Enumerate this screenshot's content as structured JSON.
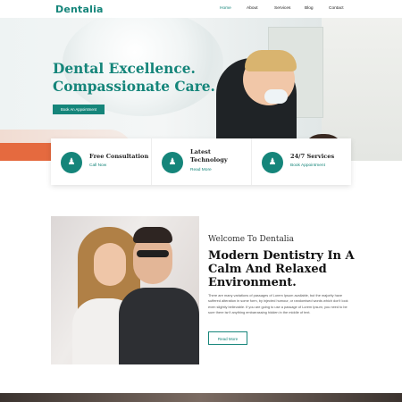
{
  "nav": {
    "logo": "Dentalia",
    "items": [
      "Home",
      "About",
      "Services",
      "Blog",
      "Contact"
    ],
    "active_index": 0
  },
  "hero": {
    "title_line1": "Dental Excellence.",
    "title_line2": "Compassionate Care.",
    "cta": "Book An Appointment"
  },
  "features": [
    {
      "title": "Free Consultation",
      "link": "Call Now",
      "icon": "user-icon"
    },
    {
      "title": "Latest Technology",
      "link": "Read More",
      "icon": "user-icon"
    },
    {
      "title": "24/7 Services",
      "link": "Book Appointment",
      "icon": "user-icon"
    }
  ],
  "about": {
    "subtitle": "Welcome To Dentalia",
    "heading": "Modern Dentistry In A Calm And Relaxed Environment.",
    "paragraph": "There are many variations of passages of Lorem Ipsum available, but the majority have suffered alteration in some form, by injected humour, or randomised words which don't look even slightly believable. If you are going to use a passage of Lorem Ipsum, you need to be sure there isn't anything embarrassing hidden in the middle of text.",
    "button": "Read More"
  },
  "colors": {
    "accent": "#15857a"
  }
}
